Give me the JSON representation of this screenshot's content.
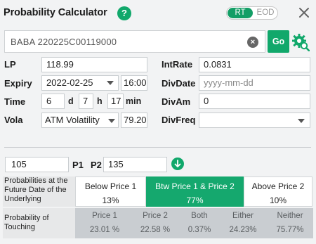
{
  "header": {
    "title": "Probability Calculator",
    "help_glyph": "?",
    "mode_on": "RT",
    "mode_off": "EOD"
  },
  "search": {
    "value": "BABA  220225C00119000",
    "go_label": "Go"
  },
  "form": {
    "lp_label": "LP",
    "lp_value": "118.99",
    "intrate_label": "IntRate",
    "intrate_value": "0.0831",
    "expiry_label": "Expiry",
    "expiry_date": "2022-02-25",
    "expiry_time": "16:00",
    "divdate_label": "DivDate",
    "divdate_placeholder": "yyyy-mm-dd",
    "time_label": "Time",
    "time_d": "6",
    "time_d_unit": "d",
    "time_h": "7",
    "time_h_unit": "h",
    "time_min": "17",
    "time_min_unit": "min",
    "divam_label": "DivAm",
    "divam_value": "0",
    "vola_label": "Vola",
    "vola_mode": "ATM Volatility",
    "vola_value": "79.20",
    "divfreq_label": "DivFreq",
    "divfreq_value": ""
  },
  "prices": {
    "p1_value": "105",
    "p1_label": "P1",
    "p2_label": "P2",
    "p2_value": "135"
  },
  "future": {
    "row_label": "Probabilities at the Future Date of the Underlying",
    "cells": [
      {
        "header": "Below Price 1",
        "value": "13%"
      },
      {
        "header": "Btw Price 1 & Price 2",
        "value": "77%"
      },
      {
        "header": "Above Price 2",
        "value": "10%"
      }
    ]
  },
  "touching": {
    "row_label": "Probability of Touching",
    "cells": [
      {
        "header": "Price 1",
        "value": "23.01 %"
      },
      {
        "header": "Price 2",
        "value": "22.58 %"
      },
      {
        "header": "Both",
        "value": "0.37%"
      },
      {
        "header": "Either",
        "value": "24.23%"
      },
      {
        "header": "Neither",
        "value": "75.77%"
      }
    ]
  },
  "colors": {
    "accent": "#11a86b",
    "background": "#f2f3f4",
    "touch_band": "#c9cdd1"
  },
  "icons": {
    "help": "help-icon",
    "close": "close-icon",
    "clear": "clear-icon",
    "settings": "gear-search-icon",
    "caret": "chevron-down-icon",
    "apply": "arrow-down-circle-icon"
  }
}
